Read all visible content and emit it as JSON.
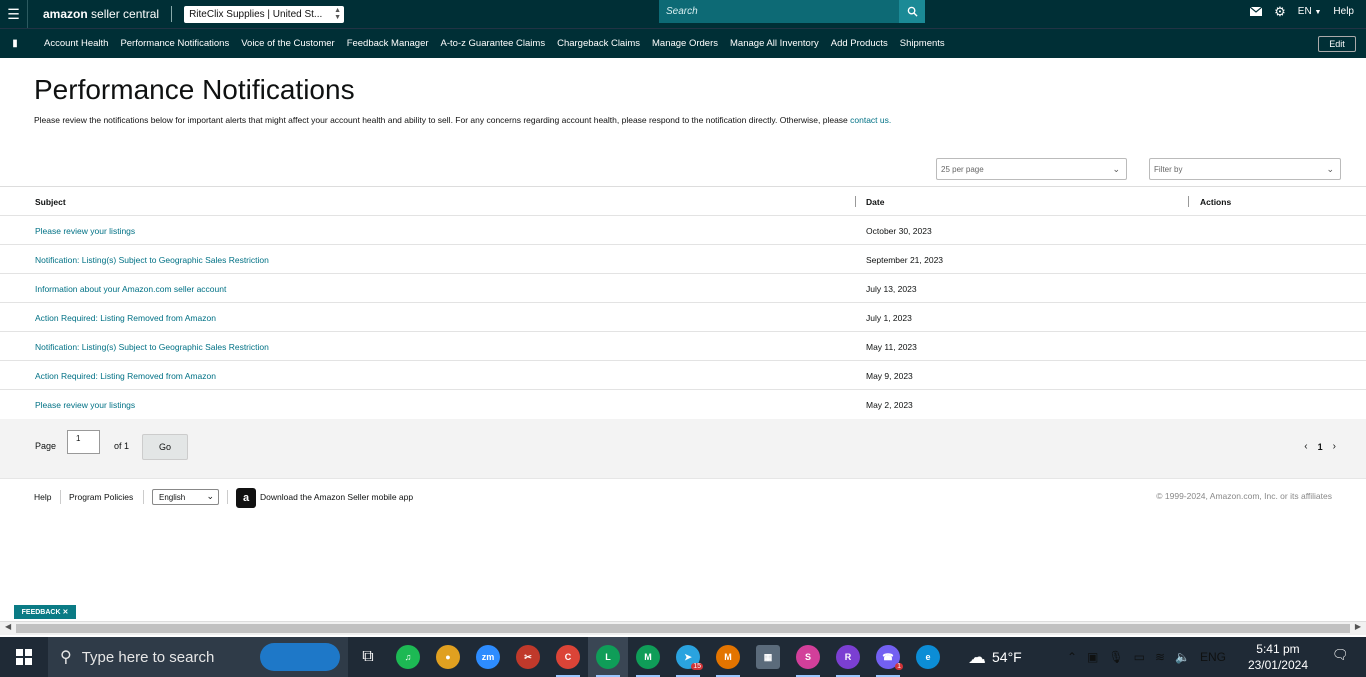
{
  "topbar": {
    "logo_brand": "amazon",
    "logo_rest": " seller central",
    "account_selector": "RiteClix Supplies | United St...",
    "search_placeholder": "Search",
    "language": "EN",
    "help": "Help"
  },
  "nav": {
    "items": [
      "Account Health",
      "Performance Notifications",
      "Voice of the Customer",
      "Feedback Manager",
      "A-to-z Guarantee Claims",
      "Chargeback Claims",
      "Manage Orders",
      "Manage All Inventory",
      "Add Products",
      "Shipments"
    ],
    "edit": "Edit"
  },
  "page": {
    "title": "Performance Notifications",
    "description": "Please review the notifications below for important alerts that might affect your account health and ability to sell. For any concerns regarding account health, please respond to the notification directly. Otherwise, please ",
    "contact_link": "contact us.",
    "per_page": "25 per page",
    "filter_placeholder": "Filter by"
  },
  "table": {
    "headers": {
      "subject": "Subject",
      "date": "Date",
      "actions": "Actions"
    },
    "rows": [
      {
        "subject": "Please review your listings",
        "date": "October 30, 2023"
      },
      {
        "subject": "Notification: Listing(s) Subject to Geographic Sales Restriction",
        "date": "September 21, 2023"
      },
      {
        "subject": "Information about your Amazon.com seller account",
        "date": "July 13, 2023"
      },
      {
        "subject": "Action Required: Listing Removed from Amazon",
        "date": "July 1, 2023"
      },
      {
        "subject": "Notification: Listing(s) Subject to Geographic Sales Restriction",
        "date": "May 11, 2023"
      },
      {
        "subject": "Action Required: Listing Removed from Amazon",
        "date": "May 9, 2023"
      },
      {
        "subject": "Please review your listings",
        "date": "May 2, 2023"
      }
    ]
  },
  "pager": {
    "page_label": "Page",
    "page_value": "1",
    "of_label": "of 1",
    "go": "Go",
    "prev": "‹",
    "current": "1",
    "next": "›"
  },
  "footer": {
    "help": "Help",
    "policies": "Program Policies",
    "language": "English",
    "app_text": "Download the Amazon Seller mobile app",
    "copyright": "© 1999-2024, Amazon.com, Inc. or its affiliates"
  },
  "feedback": "FEEDBACK ✕",
  "taskbar": {
    "search_text": "Type here to search",
    "weather": "54°F",
    "lang": "ENG",
    "time": "5:41 pm",
    "date": "23/01/2024",
    "apps": [
      {
        "name": "task-view-icon",
        "label": "⧉",
        "color": "#1f2a36"
      },
      {
        "name": "spotify-icon",
        "label": "♫",
        "color": "#1db954"
      },
      {
        "name": "app-character-icon",
        "label": "●",
        "color": "#e0a020"
      },
      {
        "name": "zoom-icon",
        "label": "zm",
        "color": "#2d8cff"
      },
      {
        "name": "snip-icon",
        "label": "✂",
        "color": "#c0392b"
      },
      {
        "name": "chrome-icon-1",
        "label": "C",
        "color": "#db4437"
      },
      {
        "name": "chrome-icon-2",
        "label": "L",
        "color": "#0f9d58"
      },
      {
        "name": "chrome-icon-3",
        "label": "M",
        "color": "#0f9d58"
      },
      {
        "name": "telegram-icon",
        "label": "➤",
        "color": "#2aa3df"
      },
      {
        "name": "chrome-icon-4",
        "label": "M",
        "color": "#e37400"
      },
      {
        "name": "calculator-icon",
        "label": "▦",
        "color": "#5b6b7b"
      },
      {
        "name": "chrome-icon-5",
        "label": "S",
        "color": "#d23f9a"
      },
      {
        "name": "chrome-icon-6",
        "label": "R",
        "color": "#7b3fd2"
      },
      {
        "name": "viber-icon",
        "label": "☎",
        "color": "#7360f2"
      },
      {
        "name": "edge-icon",
        "label": "e",
        "color": "#0c8dd6"
      }
    ],
    "telegram_badge": "15",
    "viber_badge": "1"
  }
}
